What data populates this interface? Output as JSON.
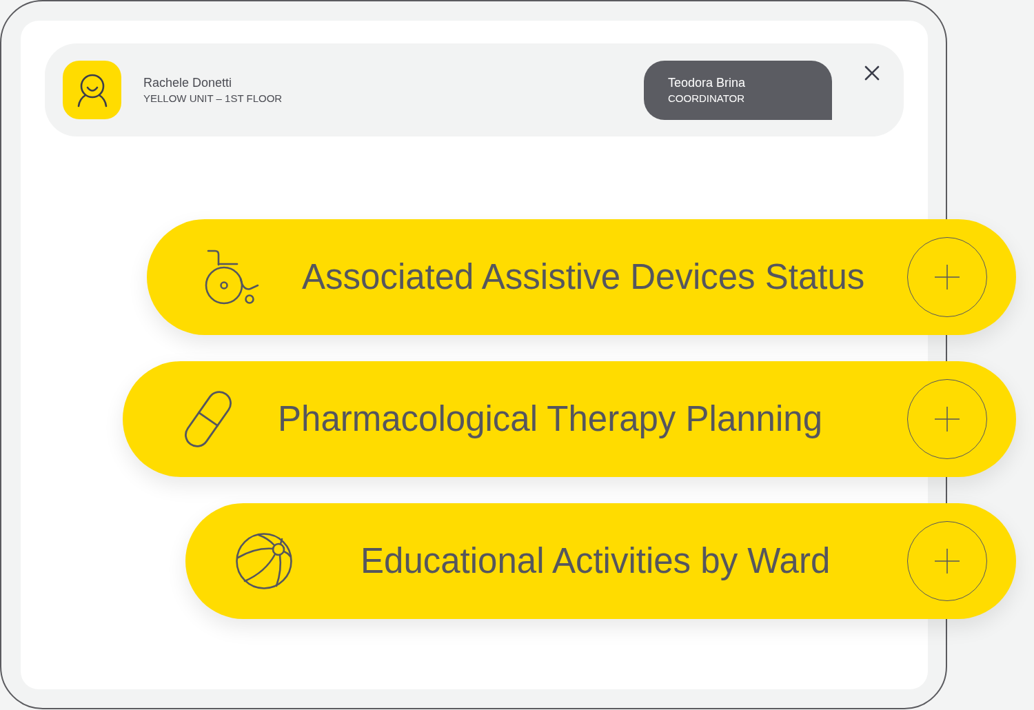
{
  "header": {
    "patient": {
      "name": "Rachele Donetti",
      "unit": "YELLOW UNIT – 1ST FLOOR"
    },
    "operator": {
      "name": "Teodora Brina",
      "role": "COORDINATOR"
    }
  },
  "cards": [
    {
      "title": "Associated Assistive Devices Status"
    },
    {
      "title": "Pharmacological Therapy Planning"
    },
    {
      "title": "Educational Activities by Ward"
    }
  ]
}
